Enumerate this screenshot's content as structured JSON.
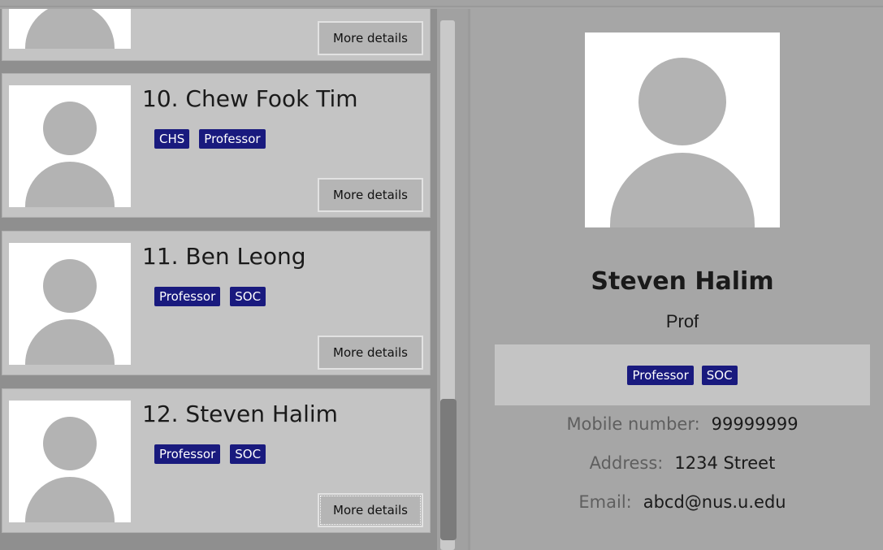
{
  "list": {
    "partial_card": {
      "button_label": "More details"
    },
    "cards": [
      {
        "name": "10. Chew Fook Tim",
        "tags": [
          "CHS",
          "Professor"
        ],
        "button_label": "More details"
      },
      {
        "name": "11. Ben Leong",
        "tags": [
          "Professor",
          "SOC"
        ],
        "button_label": "More details"
      },
      {
        "name": "12. Steven Halim",
        "tags": [
          "Professor",
          "SOC"
        ],
        "button_label": "More details"
      }
    ]
  },
  "detail": {
    "name": "Steven Halim",
    "title": "Prof",
    "tags": [
      "Professor",
      "SOC"
    ],
    "mobile_label": "Mobile number:",
    "mobile_value": "99999999",
    "address_label": "Address:",
    "address_value": "1234 Street",
    "email_label": "Email:",
    "email_value": "abcd@nus.u.edu"
  },
  "colors": {
    "tag_bg": "#191a7e",
    "card_bg": "#c4c4c4",
    "pane_bg": "#a6a6a6"
  }
}
